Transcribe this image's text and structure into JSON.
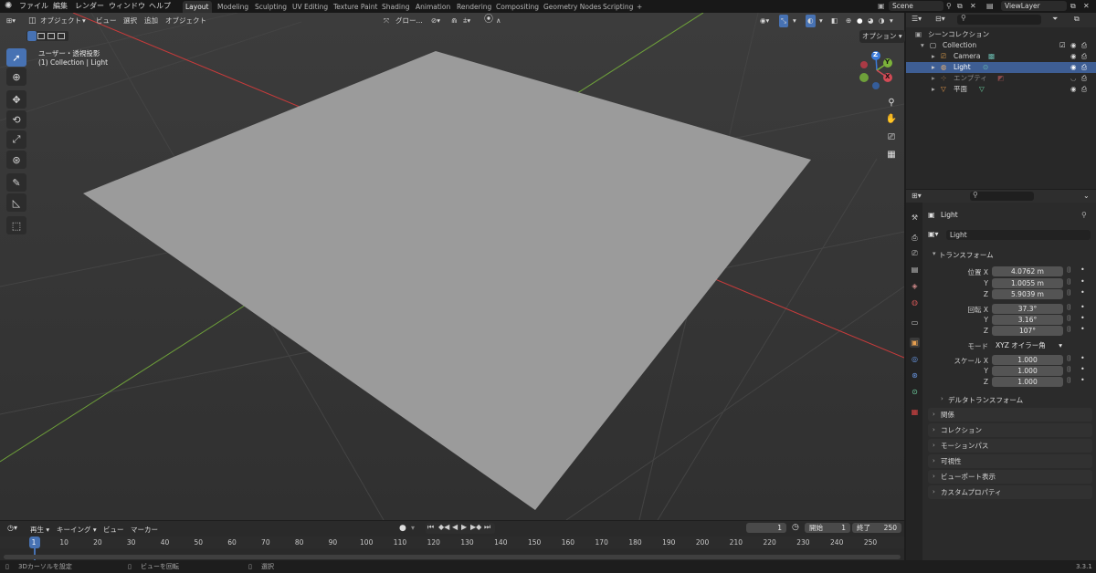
{
  "topbar": {
    "menus": [
      "ファイル",
      "編集",
      "レンダー",
      "ウィンドウ",
      "ヘルプ"
    ],
    "workspaces": [
      "Layout",
      "Modeling",
      "Sculpting",
      "UV Editing",
      "Texture Paint",
      "Shading",
      "Animation",
      "Rendering",
      "Compositing",
      "Geometry Nodes",
      "Scripting"
    ],
    "active_workspace": "Layout",
    "add_tab": "+",
    "scene": "Scene",
    "view_layer": "ViewLayer"
  },
  "viewport": {
    "mode": "オブジェクト",
    "menus": [
      "ビュー",
      "選択",
      "追加",
      "オブジェクト"
    ],
    "transform_orientation": "グロー...",
    "options": "オプション",
    "overlay_title": "ユーザー・透視投影",
    "overlay_sub": "(1) Collection | Light",
    "gizmo": {
      "z": "Z",
      "y": "Y",
      "x": "X"
    }
  },
  "outliner": {
    "title": "シーンコレクション",
    "items": [
      {
        "name": "Collection"
      },
      {
        "name": "Camera"
      },
      {
        "name": "Light",
        "selected": true
      },
      {
        "name": "エンプティ"
      },
      {
        "name": "平面"
      }
    ]
  },
  "properties": {
    "object_name": "Light",
    "object_field": "Light",
    "transform_header": "トランスフォーム",
    "location_label": "位置 X",
    "rotation_label": "回転 X",
    "scale_label": "スケール X",
    "axis_y": "Y",
    "axis_z": "Z",
    "location": [
      "4.0762 m",
      "1.0055 m",
      "5.9039 m"
    ],
    "rotation": [
      "37.3°",
      "3.16°",
      "107°"
    ],
    "mode_label": "モード",
    "mode_value": "XYZ オイラー角",
    "scale": [
      "1.000",
      "1.000",
      "1.000"
    ],
    "delta_transform": "デルタトランスフォーム",
    "panels": [
      "関係",
      "コレクション",
      "モーションパス",
      "可視性",
      "ビューポート表示",
      "カスタムプロパティ"
    ]
  },
  "timeline": {
    "menus": [
      "再生",
      "キーイング",
      "ビュー",
      "マーカー"
    ],
    "current_frame": "1",
    "start_label": "開始",
    "start_value": "1",
    "end_label": "終了",
    "end_value": "250",
    "frames": [
      "1",
      "10",
      "20",
      "30",
      "40",
      "50",
      "60",
      "70",
      "80",
      "90",
      "100",
      "110",
      "120",
      "130",
      "140",
      "150",
      "160",
      "170",
      "180",
      "190",
      "200",
      "210",
      "220",
      "230",
      "240",
      "250"
    ]
  },
  "status": {
    "left": "3Dカーソルを設定",
    "middle": "ビューを回転",
    "right": "選択",
    "version": "3.3.1"
  },
  "colors": {
    "accent": "#4772b3",
    "x_axis": "#c73b3b",
    "y_axis": "#6ea03a",
    "plane": "#9b9b9b"
  }
}
